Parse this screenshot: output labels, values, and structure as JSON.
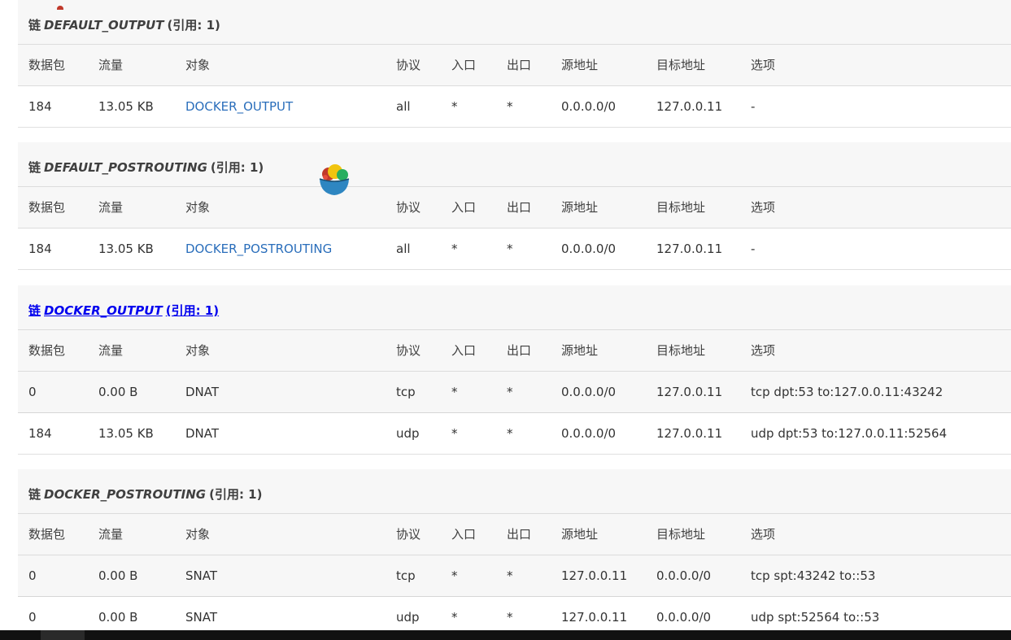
{
  "columns": [
    "数据包",
    "流量",
    "对象",
    "协议",
    "入口",
    "出口",
    "源地址",
    "目标地址",
    "选项"
  ],
  "chains": [
    {
      "prefix": "链",
      "name": "DEFAULT_OUTPUT",
      "ref": "(引用: 1)",
      "linked": false,
      "rules": [
        {
          "pkts": "184",
          "bytes": "13.05 KB",
          "target": "DOCKER_OUTPUT",
          "target_is_link": true,
          "prot": "all",
          "in": "*",
          "out": "*",
          "src": "0.0.0.0/0",
          "dst": "127.0.0.11",
          "opts": "-"
        }
      ]
    },
    {
      "prefix": "链",
      "name": "DEFAULT_POSTROUTING",
      "ref": "(引用: 1)",
      "linked": false,
      "rules": [
        {
          "pkts": "184",
          "bytes": "13.05 KB",
          "target": "DOCKER_POSTROUTING",
          "target_is_link": true,
          "prot": "all",
          "in": "*",
          "out": "*",
          "src": "0.0.0.0/0",
          "dst": "127.0.0.11",
          "opts": "-"
        }
      ]
    },
    {
      "prefix": "链",
      "name": "DOCKER_OUTPUT",
      "ref": "(引用: 1)",
      "linked": true,
      "rules": [
        {
          "pkts": "0",
          "bytes": "0.00 B",
          "target": "DNAT",
          "target_is_link": false,
          "prot": "tcp",
          "in": "*",
          "out": "*",
          "src": "0.0.0.0/0",
          "dst": "127.0.0.11",
          "opts": "tcp dpt:53 to:127.0.0.11:43242"
        },
        {
          "pkts": "184",
          "bytes": "13.05 KB",
          "target": "DNAT",
          "target_is_link": false,
          "prot": "udp",
          "in": "*",
          "out": "*",
          "src": "0.0.0.0/0",
          "dst": "127.0.0.11",
          "opts": "udp dpt:53 to:127.0.0.11:52564"
        }
      ]
    },
    {
      "prefix": "链",
      "name": "DOCKER_POSTROUTING",
      "ref": "(引用: 1)",
      "linked": false,
      "rules": [
        {
          "pkts": "0",
          "bytes": "0.00 B",
          "target": "SNAT",
          "target_is_link": false,
          "prot": "tcp",
          "in": "*",
          "out": "*",
          "src": "127.0.0.11",
          "dst": "0.0.0.0/0",
          "opts": "tcp spt:43242 to::53"
        },
        {
          "pkts": "0",
          "bytes": "0.00 B",
          "target": "SNAT",
          "target_is_link": false,
          "prot": "udp",
          "in": "*",
          "out": "*",
          "src": "127.0.0.11",
          "dst": "0.0.0.0/0",
          "opts": "udp spt:52564 to::53"
        }
      ]
    }
  ],
  "icons": {
    "floating": "fruit-bowl-icon",
    "taskbar": "app-taskbar-icon"
  },
  "colors": {
    "link": "#2a6ebb",
    "chain_link": "#0000ee",
    "panel_bg": "#f7f7f7"
  }
}
